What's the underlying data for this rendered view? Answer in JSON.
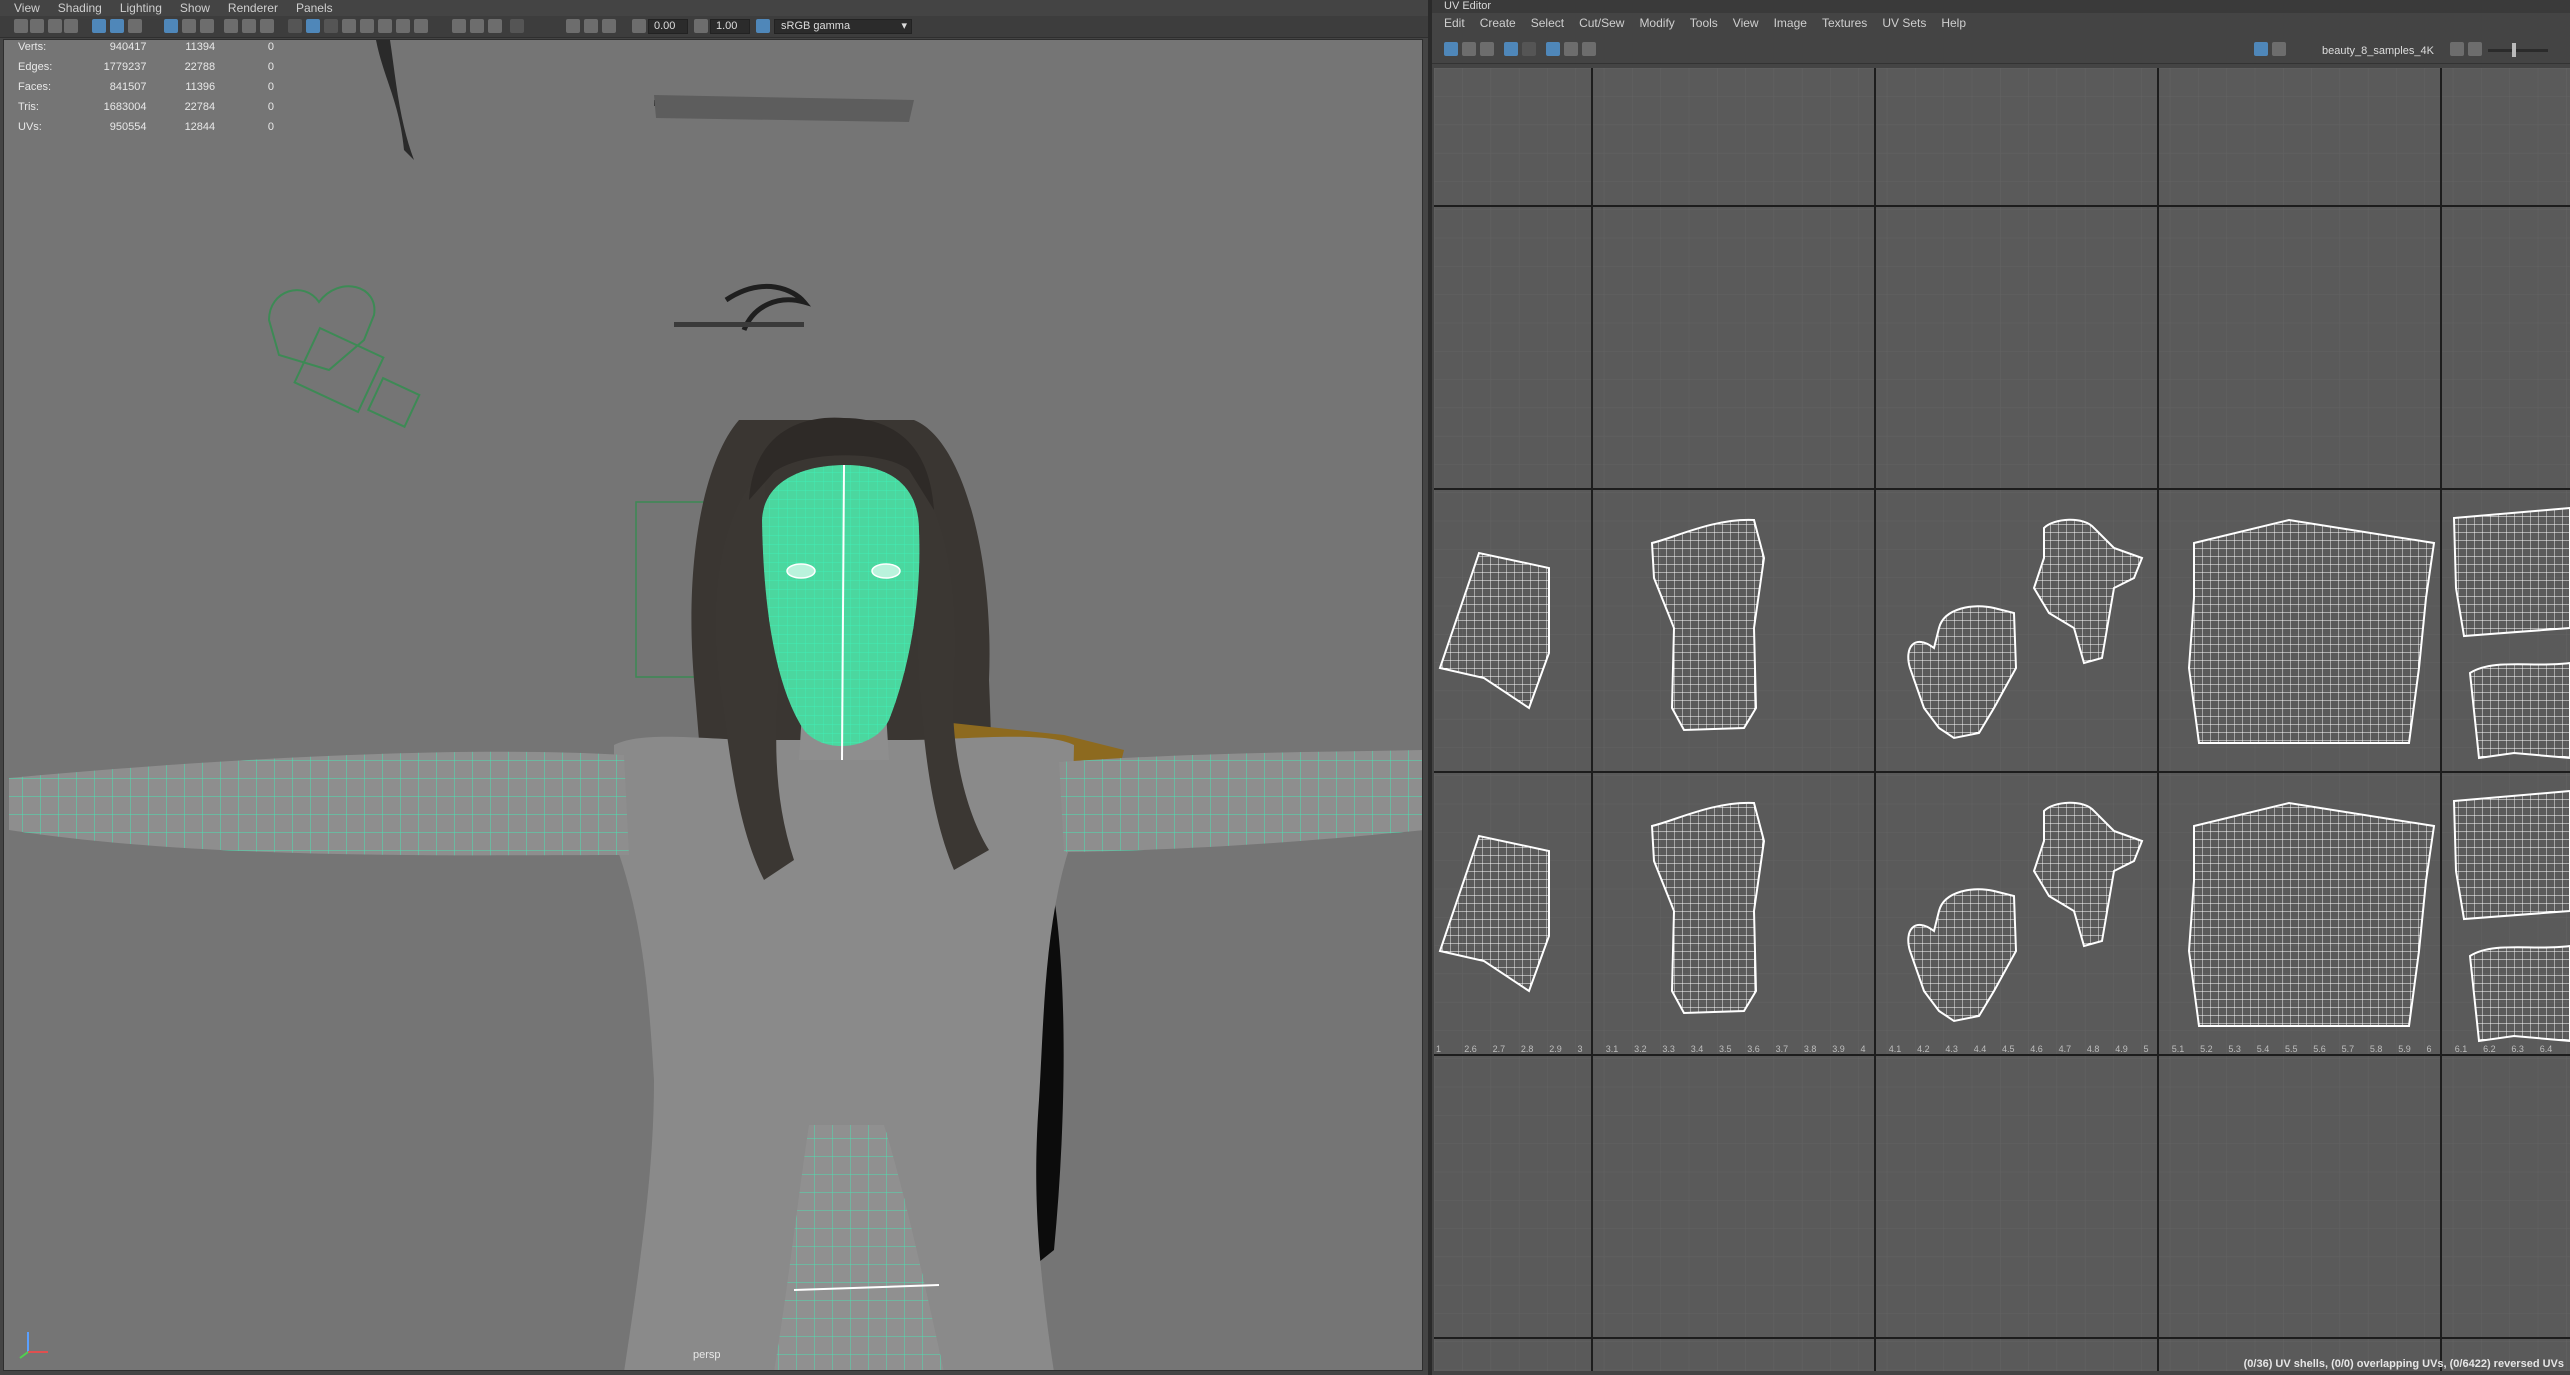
{
  "viewport": {
    "menu": [
      "View",
      "Shading",
      "Lighting",
      "Show",
      "Renderer",
      "Panels"
    ],
    "exposure_value": "0.00",
    "gamma_value": "1.00",
    "color_space": "sRGB gamma",
    "camera_label": "persp",
    "hud": [
      {
        "label": "Verts:",
        "v1": "940417",
        "v2": "11394",
        "v3": "0"
      },
      {
        "label": "Edges:",
        "v1": "1779237",
        "v2": "22788",
        "v3": "0"
      },
      {
        "label": "Faces:",
        "v1": "841507",
        "v2": "11396",
        "v3": "0"
      },
      {
        "label": "Tris:",
        "v1": "1683004",
        "v2": "22784",
        "v3": "0"
      },
      {
        "label": "UVs:",
        "v1": "950554",
        "v2": "12844",
        "v3": "0"
      }
    ]
  },
  "uv_editor": {
    "title": "UV Editor",
    "menu": [
      "Edit",
      "Create",
      "Select",
      "Cut/Sew",
      "Modify",
      "Tools",
      "View",
      "Image",
      "Textures",
      "UV Sets",
      "Help"
    ],
    "texture_name": "beauty_8_samples_4K",
    "status": "(0/36) UV shells, (0/0) overlapping UVs, (0/6422) reversed UVs",
    "axis_ticks": [
      "1",
      "2.6",
      "2.7",
      "2.8",
      "2.9",
      "3",
      "3.1",
      "3.2",
      "3.3",
      "3.4",
      "3.5",
      "3.6",
      "3.7",
      "3.8",
      "3.9",
      "4",
      "4.1",
      "4.2",
      "4.3",
      "4.4",
      "4.5",
      "4.6",
      "4.7",
      "4.8",
      "4.9",
      "5",
      "5.1",
      "5.2",
      "5.3",
      "5.4",
      "5.5",
      "5.6",
      "5.7",
      "5.8",
      "5.9",
      "6",
      "6.1",
      "6.2",
      "6.3",
      "6.4"
    ]
  },
  "icons": [
    "camera-icon",
    "grid-icon",
    "wireframe-icon",
    "smooth-shade-icon",
    "isolate-icon",
    "gear-icon",
    "checker-icon",
    "axis-gizmo-icon"
  ],
  "colors": {
    "wire": "#3ff0b8",
    "background": "#757575",
    "uv_bg": "#5a5a5a",
    "accent": "#4f87b9"
  }
}
